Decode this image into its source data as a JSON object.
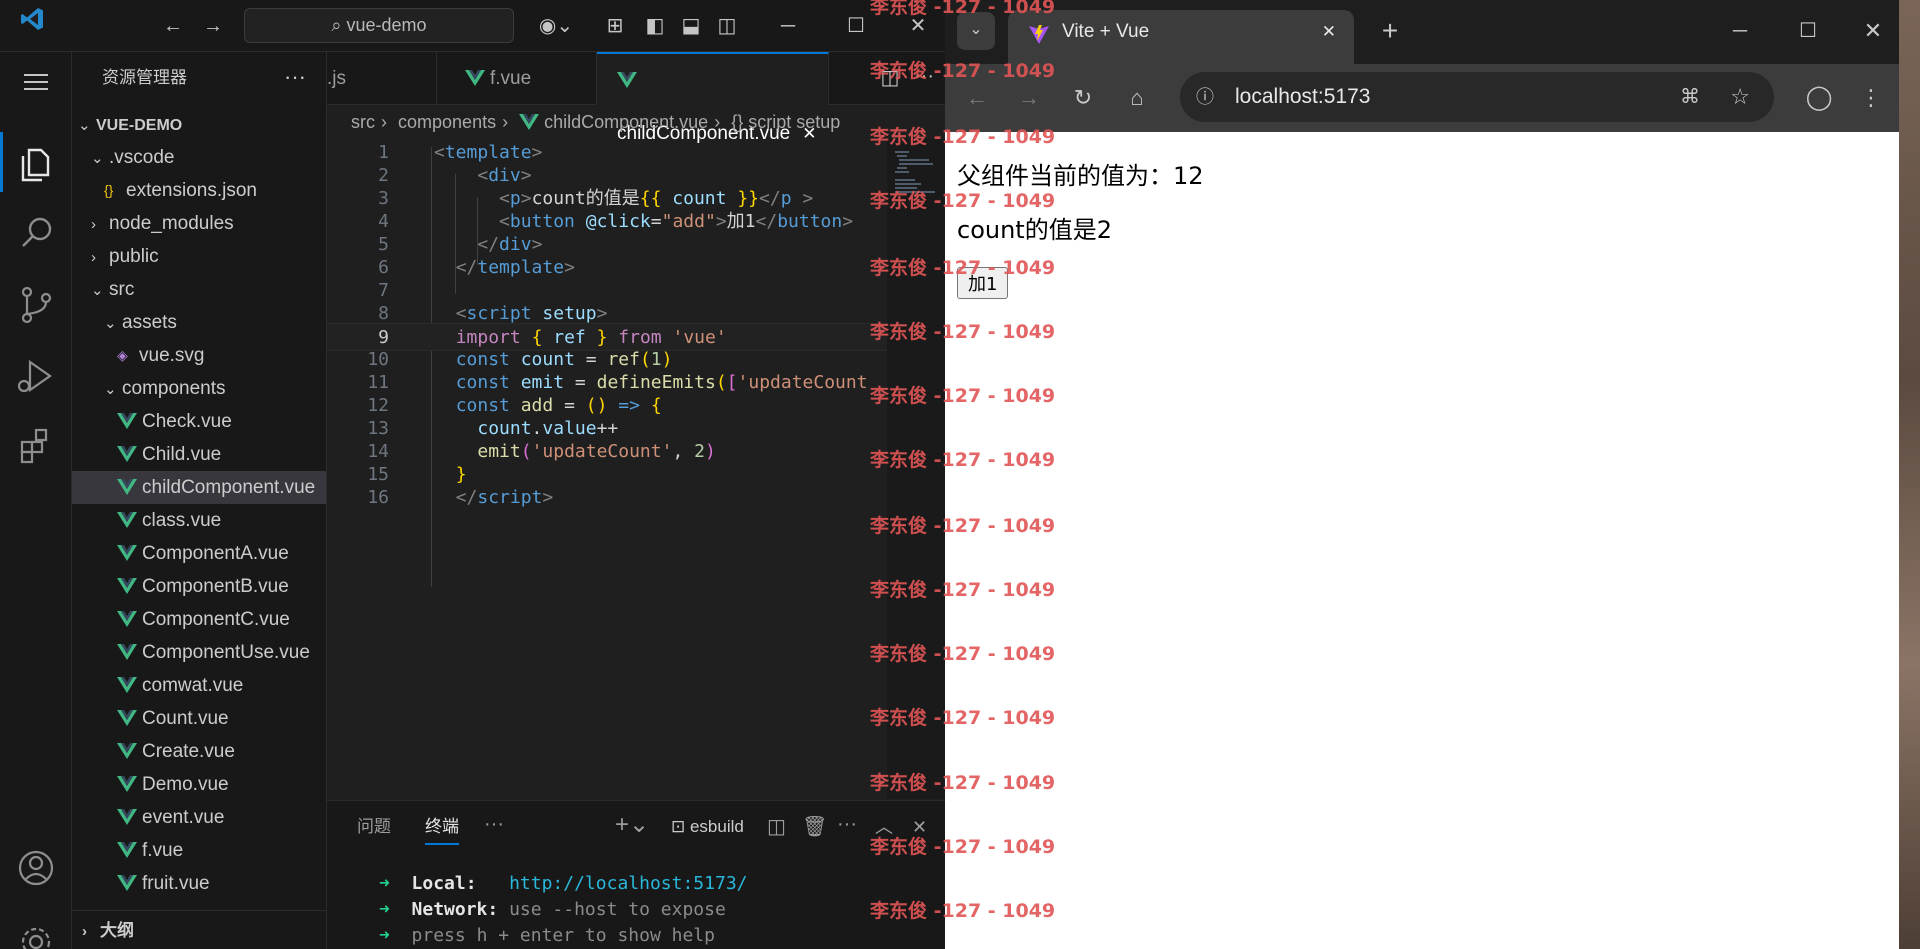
{
  "vscode": {
    "search_text": "vue-demo",
    "sidebar": {
      "title": "资源管理器",
      "more": "···",
      "tree": [
        {
          "label": "VUE-DEMO",
          "kind": "root"
        },
        {
          "label": ".vscode",
          "kind": "folder"
        },
        {
          "label": "extensions.json",
          "kind": "json"
        },
        {
          "label": "node_modules",
          "kind": "folder-closed"
        },
        {
          "label": "public",
          "kind": "folder-closed"
        },
        {
          "label": "src",
          "kind": "folder"
        },
        {
          "label": "assets",
          "kind": "folder"
        },
        {
          "label": "vue.svg",
          "kind": "svg"
        },
        {
          "label": "components",
          "kind": "folder"
        },
        {
          "label": "Check.vue",
          "kind": "vue"
        },
        {
          "label": "Child.vue",
          "kind": "vue"
        },
        {
          "label": "childComponent.vue",
          "kind": "vue",
          "selected": true
        },
        {
          "label": "class.vue",
          "kind": "vue"
        },
        {
          "label": "ComponentA.vue",
          "kind": "vue"
        },
        {
          "label": "ComponentB.vue",
          "kind": "vue"
        },
        {
          "label": "ComponentC.vue",
          "kind": "vue"
        },
        {
          "label": "ComponentUse.vue",
          "kind": "vue"
        },
        {
          "label": "comwat.vue",
          "kind": "vue"
        },
        {
          "label": "Count.vue",
          "kind": "vue"
        },
        {
          "label": "Create.vue",
          "kind": "vue"
        },
        {
          "label": "Demo.vue",
          "kind": "vue"
        },
        {
          "label": "event.vue",
          "kind": "vue"
        },
        {
          "label": "f.vue",
          "kind": "vue"
        },
        {
          "label": "fruit.vue",
          "kind": "vue"
        }
      ],
      "outline": "大纲"
    },
    "tabs": [
      {
        "label": ".js",
        "active": false
      },
      {
        "label": "f.vue",
        "active": false
      },
      {
        "label": "childComponent.vue",
        "active": true
      }
    ],
    "tab_close": "✕",
    "breadcrumb": [
      "src",
      "components",
      "childComponent.vue",
      "{} script setup"
    ],
    "code_lines": [
      {
        "n": "1"
      },
      {
        "n": "2"
      },
      {
        "n": "3"
      },
      {
        "n": "4"
      },
      {
        "n": "5"
      },
      {
        "n": "6"
      },
      {
        "n": "7"
      },
      {
        "n": "8"
      },
      {
        "n": "9",
        "current": true
      },
      {
        "n": "10"
      },
      {
        "n": "11"
      },
      {
        "n": "12"
      },
      {
        "n": "13"
      },
      {
        "n": "14"
      },
      {
        "n": "15"
      },
      {
        "n": "16"
      }
    ],
    "panel": {
      "tabs": [
        "问题",
        "终端"
      ],
      "active_tab": "终端",
      "terminal_name": "esbuild",
      "terminal_lines": [
        {
          "arrow": "➜",
          "label": "Local:",
          "value": "http://localhost:5173/"
        },
        {
          "arrow": "➜",
          "label": "Network:",
          "value": "use --host to expose"
        },
        {
          "arrow": "➜",
          "label": "press",
          "value": "h + enter to show help"
        }
      ]
    }
  },
  "browser": {
    "tab_title": "Vite + Vue",
    "url": "localhost:5173",
    "page": {
      "parent_text": "父组件当前的值为：12",
      "count_text": "count的值是2",
      "button_label": "加1"
    }
  },
  "watermark": "李东俊 -127 - 1049",
  "colors": {
    "accent": "#0078d4",
    "vue_green": "#41b883",
    "watermark": "#e25555"
  }
}
